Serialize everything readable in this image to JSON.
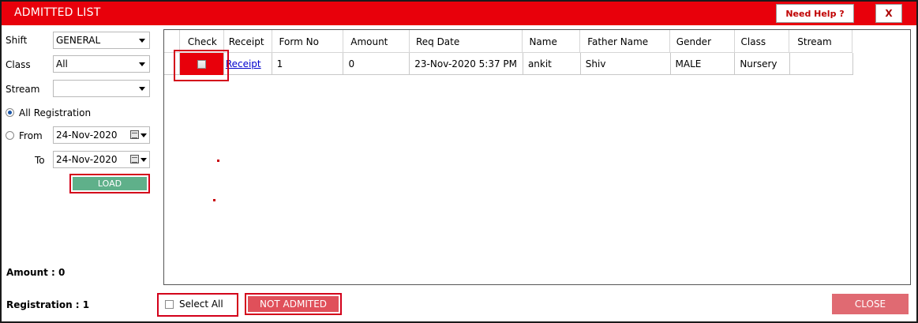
{
  "window": {
    "title": "ADMITTED LIST",
    "help_label": "Need Help ?",
    "close_label": "X"
  },
  "filters": {
    "shift_label": "Shift",
    "shift_value": "GENERAL",
    "class_label": "Class",
    "class_value": "All",
    "stream_label": "Stream",
    "stream_value": "",
    "all_registration_label": "All Registration",
    "all_registration_selected": true,
    "from_label": "From",
    "from_value": "24-Nov-2020",
    "to_label": "To",
    "to_value": "24-Nov-2020",
    "load_label": "LOAD"
  },
  "summary": {
    "amount": "Amount : 0",
    "registration": "Registration : 1"
  },
  "grid": {
    "columns": [
      "Check",
      "Receipt",
      "Form No",
      "Amount",
      "Req Date",
      "Name",
      "Father Name",
      "Gender",
      "Class",
      "Stream"
    ],
    "rows": [
      {
        "checked": false,
        "receipt": "Receipt",
        "form_no": "1",
        "amount": "0",
        "req_date": "23-Nov-2020 5:37 PM",
        "name": "ankit",
        "father_name": "Shiv",
        "gender": "MALE",
        "class": "Nursery",
        "stream": ""
      }
    ]
  },
  "footer": {
    "select_all_label": "Select All",
    "not_admitted_label": "NOT ADMITED",
    "close_label": "CLOSE"
  },
  "colors": {
    "accent": "#e8000b",
    "load_button": "#5fb08a",
    "not_admitted_button": "#e0505a",
    "close_button": "#e06a72",
    "highlight_border": "#d3001a"
  }
}
